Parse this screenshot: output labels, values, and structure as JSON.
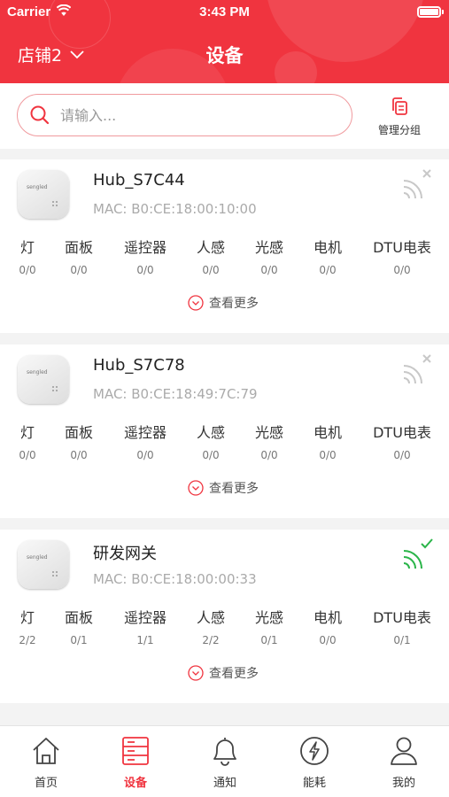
{
  "status_bar": {
    "carrier": "Carrier",
    "time": "3:43 PM"
  },
  "header": {
    "store": "店铺2",
    "title": "设备"
  },
  "search": {
    "placeholder": "请输入..."
  },
  "manage_group": {
    "label": "管理分组"
  },
  "stat_labels": [
    "灯",
    "面板",
    "遥控器",
    "人感",
    "光感",
    "电机",
    "DTU电表"
  ],
  "view_more_label": "查看更多",
  "devices": [
    {
      "name": "Hub_S7C44",
      "mac": "MAC: B0:CE:18:00:10:00",
      "online": false,
      "values": [
        "0/0",
        "0/0",
        "0/0",
        "0/0",
        "0/0",
        "0/0",
        "0/0"
      ]
    },
    {
      "name": "Hub_S7C78",
      "mac": "MAC: B0:CE:18:49:7C:79",
      "online": false,
      "values": [
        "0/0",
        "0/0",
        "0/0",
        "0/0",
        "0/0",
        "0/0",
        "0/0"
      ]
    },
    {
      "name": "研发网关",
      "mac": "MAC: B0:CE:18:00:00:33",
      "online": true,
      "values": [
        "2/2",
        "0/1",
        "1/1",
        "2/2",
        "0/1",
        "0/0",
        "0/1"
      ]
    }
  ],
  "tabs": [
    {
      "label": "首页",
      "icon": "home-icon",
      "active": false
    },
    {
      "label": "设备",
      "icon": "device-list-icon",
      "active": true
    },
    {
      "label": "通知",
      "icon": "bell-icon",
      "active": false
    },
    {
      "label": "能耗",
      "icon": "lightning-icon",
      "active": false
    },
    {
      "label": "我的",
      "icon": "user-icon",
      "active": false
    }
  ],
  "colors": {
    "brand": "#f0343f",
    "online": "#2bb54a",
    "offline": "#c8c8c8"
  }
}
